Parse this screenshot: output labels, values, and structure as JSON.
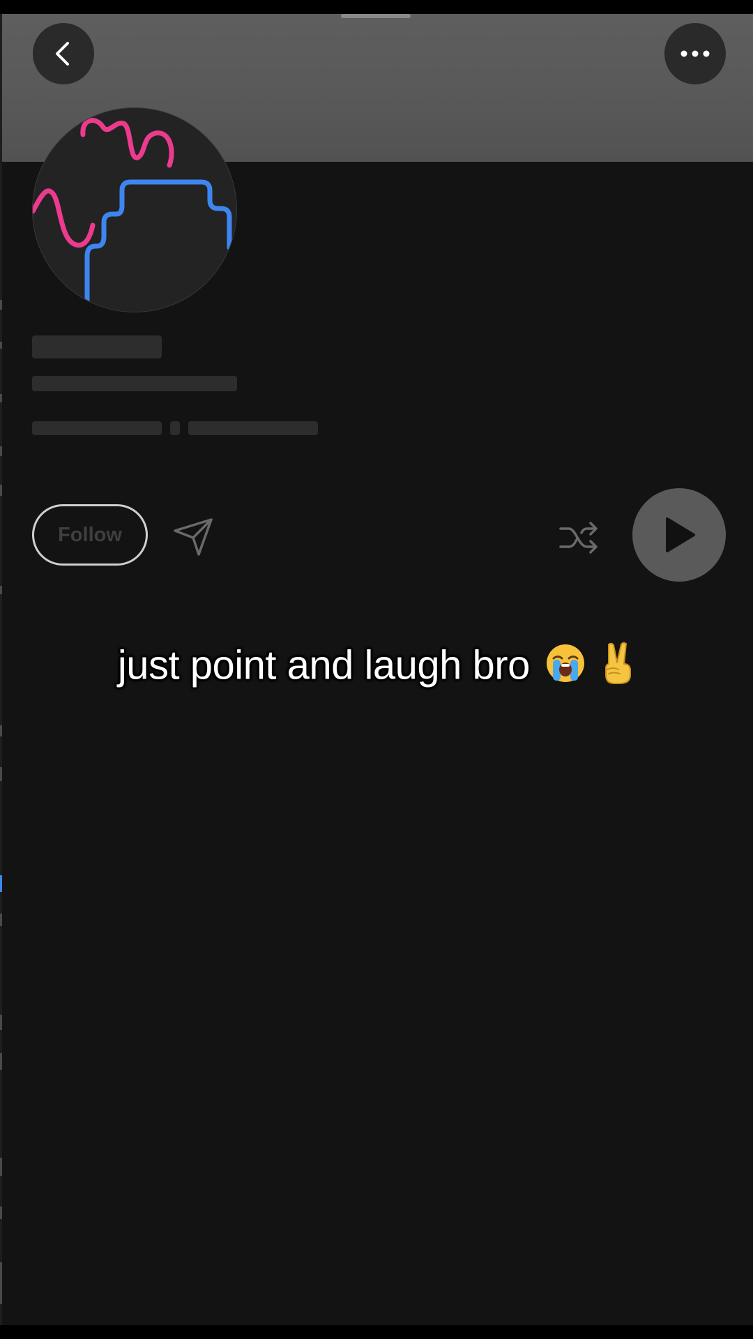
{
  "profile": {
    "follow_label": "Follow"
  },
  "overlay": {
    "caption_text": "just point and laugh bro",
    "caption_emojis": [
      "loudly-crying-face",
      "victory-hand"
    ]
  },
  "icons": {
    "back": "chevron-left-icon",
    "more": "more-horizontal-icon",
    "share": "send-icon",
    "shuffle": "shuffle-icon",
    "play": "play-icon"
  },
  "colors": {
    "background": "#131313",
    "banner": "#5a5a5a",
    "avatar_pink_stroke": "#ec3b8e",
    "avatar_blue_stroke": "#3d86f0",
    "play_button": "#5a5a5a"
  }
}
